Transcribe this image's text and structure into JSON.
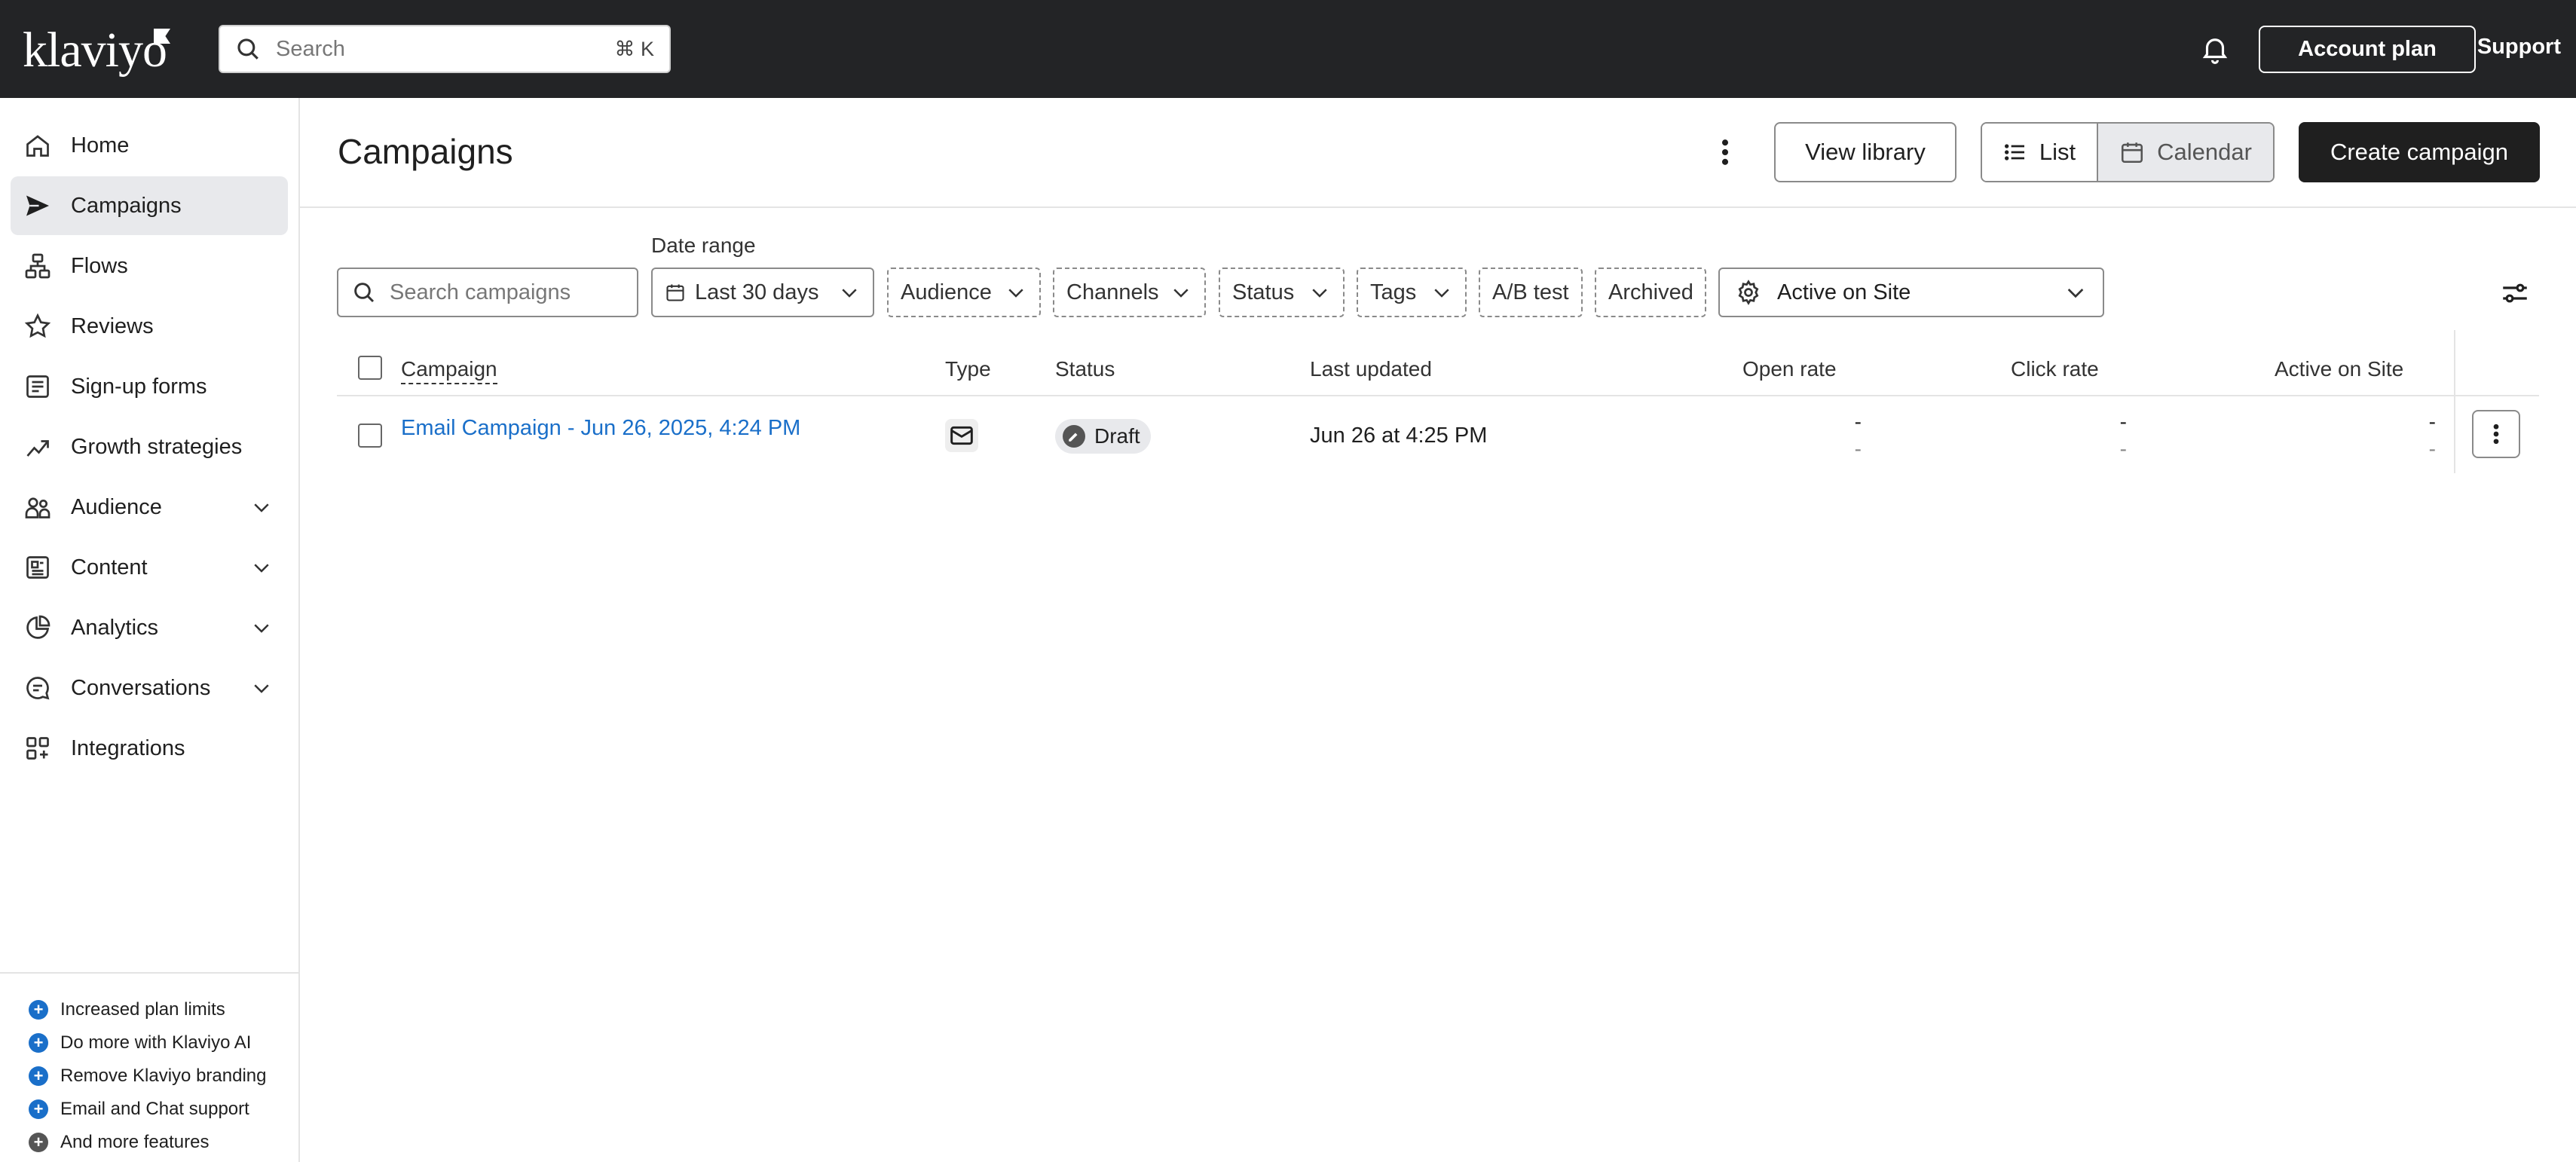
{
  "topbar": {
    "logo": "klaviyo",
    "search_placeholder": "Search",
    "shortcut": "⌘ K",
    "account_plan": "Account plan",
    "support": "Support"
  },
  "sidebar": {
    "items": [
      {
        "label": "Home",
        "icon": "home-icon"
      },
      {
        "label": "Campaigns",
        "icon": "send-icon",
        "active": true
      },
      {
        "label": "Flows",
        "icon": "flows-icon"
      },
      {
        "label": "Reviews",
        "icon": "star-icon"
      },
      {
        "label": "Sign-up forms",
        "icon": "form-icon"
      },
      {
        "label": "Growth strategies",
        "icon": "trend-icon"
      },
      {
        "label": "Audience",
        "icon": "users-icon",
        "expandable": true
      },
      {
        "label": "Content",
        "icon": "content-icon",
        "expandable": true
      },
      {
        "label": "Analytics",
        "icon": "pie-icon",
        "expandable": true
      },
      {
        "label": "Conversations",
        "icon": "chat-icon",
        "expandable": true
      },
      {
        "label": "Integrations",
        "icon": "apps-icon"
      }
    ],
    "promos": [
      "Increased plan limits",
      "Do more with Klaviyo AI",
      "Remove Klaviyo branding",
      "Email and Chat support",
      "And more features"
    ]
  },
  "main": {
    "title": "Campaigns",
    "view_library": "View library",
    "view_list": "List",
    "view_calendar": "Calendar",
    "create_campaign": "Create campaign",
    "date_range_label": "Date range",
    "filters": {
      "search_placeholder": "Search campaigns",
      "date_range": "Last 30 days",
      "audience": "Audience",
      "channels": "Channels",
      "status": "Status",
      "tags": "Tags",
      "ab_test": "A/B test",
      "archived": "Archived",
      "metric": "Active on Site"
    },
    "table": {
      "columns": [
        "Campaign",
        "Type",
        "Status",
        "Last updated",
        "Open rate",
        "Click rate",
        "Active on Site"
      ],
      "rows": [
        {
          "campaign": "Email Campaign - Jun 26, 2025, 4:24 PM",
          "type": "email",
          "status": "Draft",
          "last_updated": "Jun 26 at 4:25 PM",
          "open_rate": "-",
          "open_rate_sub": "-",
          "click_rate": "-",
          "click_rate_sub": "-",
          "active_on_site": "-",
          "active_on_site_sub": "-"
        }
      ]
    }
  },
  "colors": {
    "topbar": "#232426",
    "link": "#1a6fc9",
    "active_nav": "#e8e9ec",
    "primary_button": "#1f1f1f"
  }
}
